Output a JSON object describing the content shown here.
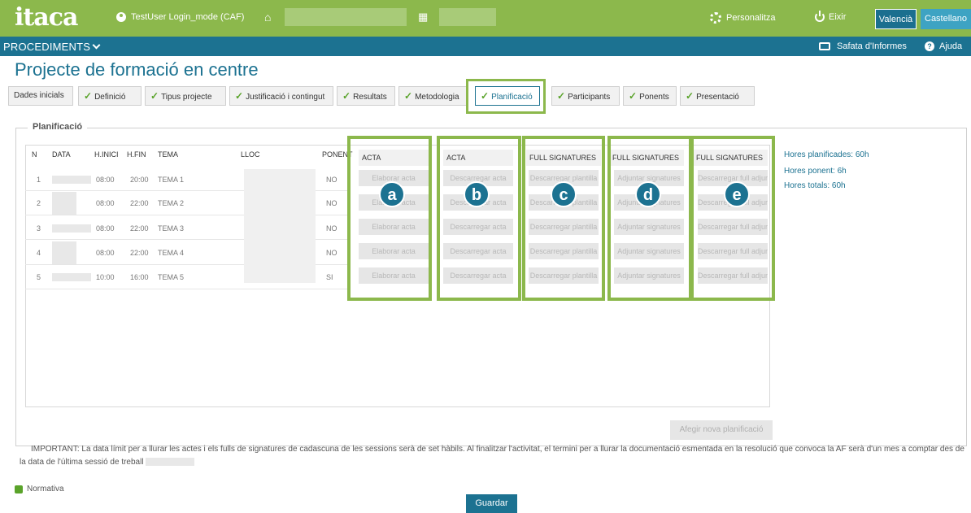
{
  "header": {
    "logo": "itaca",
    "user": "TestUser Login_mode (CAF)",
    "personalitza": "Personalitza",
    "exit": "Eixir",
    "lang_valencia": "Valencià",
    "lang_castellano": "Castellano"
  },
  "menubar": {
    "procediments": "PROCEDIMENTS",
    "safata": "Safata d'Informes",
    "ajuda": "Ajuda"
  },
  "page": {
    "title": "Projecte de formació en centre"
  },
  "tabs": [
    {
      "label": "Dades inicials",
      "check": false
    },
    {
      "label": "Definició",
      "check": true
    },
    {
      "label": "Tipus projecte",
      "check": true
    },
    {
      "label": "Justificació i contingut",
      "check": true
    },
    {
      "label": "Resultats",
      "check": true
    },
    {
      "label": "Metodologia",
      "check": true
    },
    {
      "label": "Planificació",
      "check": true,
      "active": true
    },
    {
      "label": "Participants",
      "check": true
    },
    {
      "label": "Ponents",
      "check": true
    },
    {
      "label": "Presentació",
      "check": true
    }
  ],
  "panel": {
    "legend": "Planificació",
    "columns": [
      "N",
      "DATA",
      "H.INICI",
      "H.FIN",
      "TEMA",
      "LLOC",
      "PONENT"
    ],
    "action_headers": [
      "ACTA",
      "ACTA",
      "FULL SIGNATURES",
      "FULL SIGNATURES",
      "FULL SIGNATURES"
    ],
    "rows": [
      {
        "n": "1",
        "hinici": "08:00",
        "hfin": "20:00",
        "tema": "TEMA 1",
        "ponent": "NO"
      },
      {
        "n": "2",
        "hinici": "08:00",
        "hfin": "22:00",
        "tema": "TEMA 2",
        "ponent": "NO"
      },
      {
        "n": "3",
        "hinici": "08:00",
        "hfin": "22:00",
        "tema": "TEMA 3",
        "ponent": "NO"
      },
      {
        "n": "4",
        "hinici": "08:00",
        "hfin": "22:00",
        "tema": "TEMA 4",
        "ponent": "NO"
      },
      {
        "n": "5",
        "hinici": "10:00",
        "hfin": "16:00",
        "tema": "TEMA 5",
        "ponent": "SI"
      }
    ],
    "buttons": {
      "elaborar": "Elaborar acta",
      "descarregar_acta": "Descarregar acta",
      "descarregar_plantilla": "Descarregar plantilla",
      "adjuntar": "Adjuntar signatures",
      "descarregar_full": "Descarregar full adjunt"
    },
    "badges": [
      "a",
      "b",
      "c",
      "d",
      "e"
    ],
    "hours": {
      "planificades": "Hores planificades: 60h",
      "ponent": "Hores ponent: 6h",
      "totals": "Hores totals: 60h"
    },
    "afegir": "Afegir nova planificació"
  },
  "footer": {
    "important": "IMPORTANT: La data límit per a llurar les actes i els fulls de signatures de cadascuna de les sessions serà de set hàbils. Al finalitzar l'activitat, el termini per a llurar la documentació esmentada en la resolució que convoca la AF serà d'un mes a comptar des de la data de l'última sessió de treball",
    "normativa": "Normativa",
    "guardar": "Guardar"
  },
  "colors": {
    "green": "#8cb84c",
    "blue": "#1c7291",
    "light_blue": "#3ea3c3",
    "check": "#5aa32a"
  }
}
